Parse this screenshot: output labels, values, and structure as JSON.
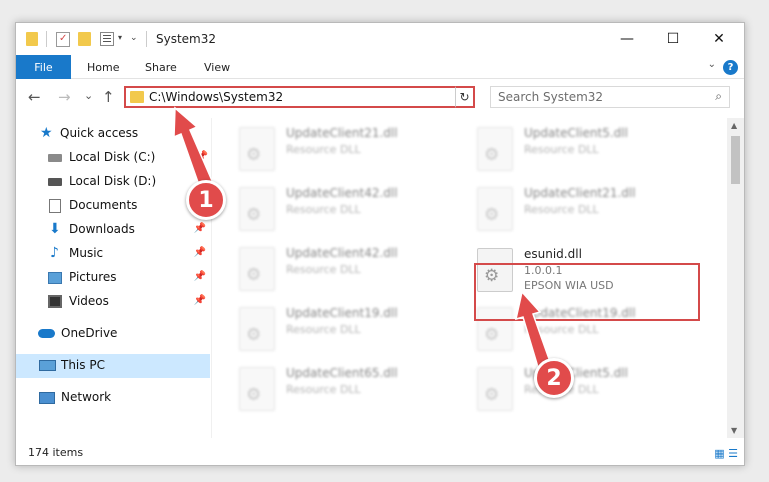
{
  "window": {
    "title": "System32",
    "controls": {
      "minimize": "—",
      "maximize": "☐",
      "close": "✕"
    }
  },
  "ribbon": {
    "file": "File",
    "tabs": [
      "Home",
      "Share",
      "View"
    ],
    "help": "?",
    "collapse": "⌄"
  },
  "nav": {
    "back": "←",
    "forward": "→",
    "recent": "⌄",
    "up": "↑",
    "address": "C:\\Windows\\System32",
    "address_chevron": "⌄",
    "refresh": "↻",
    "search_placeholder": "Search System32",
    "search_glyph": "⌕"
  },
  "sidebar": {
    "items": [
      {
        "label": "Quick access",
        "icon": "star-icon"
      },
      {
        "label": "Local Disk (C:)",
        "icon": "drive-icon"
      },
      {
        "label": "Local Disk (D:)",
        "icon": "drive-icon"
      },
      {
        "label": "Documents",
        "icon": "documents-icon"
      },
      {
        "label": "Downloads",
        "icon": "download-icon",
        "pin": "📌"
      },
      {
        "label": "Music",
        "icon": "music-icon",
        "pin": "📌"
      },
      {
        "label": "Pictures",
        "icon": "pictures-icon",
        "pin": "📌"
      },
      {
        "label": "Videos",
        "icon": "videos-icon",
        "pin": "📌"
      },
      {
        "label": "OneDrive",
        "icon": "cloud-icon"
      },
      {
        "label": "This PC",
        "icon": "computer-icon",
        "selected": true
      },
      {
        "label": "Network",
        "icon": "network-icon"
      }
    ]
  },
  "files": {
    "left": [
      {
        "name": "UpdateClient21.dll",
        "type": "Resource DLL"
      },
      {
        "name": "UpdateClient42.dll",
        "type": "Resource DLL"
      },
      {
        "name": "UpdateClient42.dll",
        "type": "Resource DLL"
      },
      {
        "name": "UpdateClient19.dll",
        "type": "Resource DLL"
      },
      {
        "name": "UpdateClient65.dll",
        "type": "Resource DLL"
      }
    ],
    "right": [
      {
        "name": "UpdateClient5.dll",
        "type": "Resource DLL"
      },
      {
        "name": "UpdateClient21.dll",
        "type": "Resource DLL"
      },
      {
        "name": "esunid.dll",
        "version": "1.0.0.1",
        "type": "EPSON WIA USD",
        "highlighted": true
      },
      {
        "name": "UpdateClient19.dll",
        "type": "Resource DLL"
      },
      {
        "name": "UpdateClient5.dll",
        "type": "Resource DLL"
      }
    ]
  },
  "status": {
    "count": "174 items"
  },
  "annotations": {
    "step1": "1",
    "step2": "2",
    "color": "#e14b4b"
  },
  "colors": {
    "accent": "#1979ca",
    "highlight": "#d44a4a",
    "selected": "#cce8ff"
  }
}
